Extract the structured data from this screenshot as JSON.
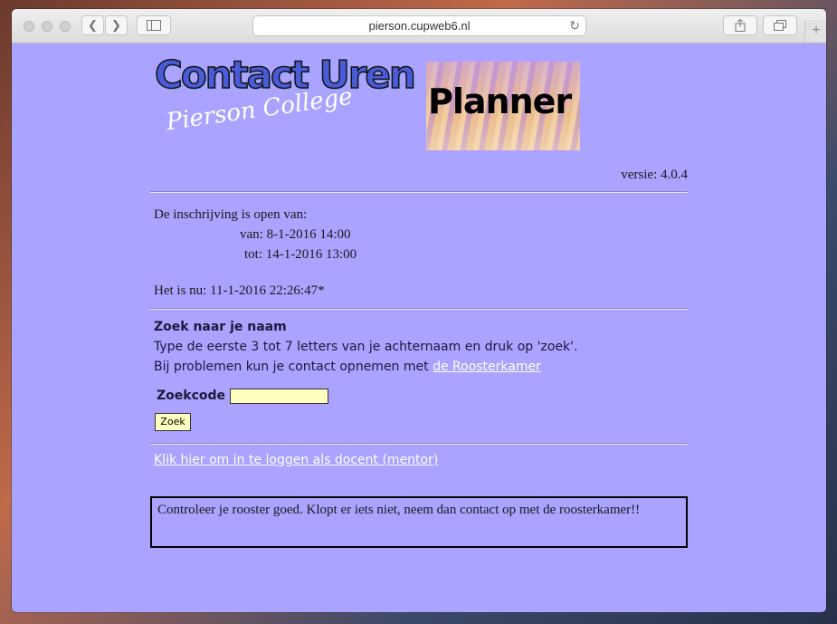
{
  "browser": {
    "url": "pierson.cupweb6.nl"
  },
  "logo": {
    "title": "Contact Uren",
    "subtitle": "Pierson College",
    "planner": "Planner"
  },
  "version": "versie: 4.0.4",
  "registration": {
    "intro": "De inschrijving is open van:",
    "from": "van: 8-1-2016 14:00",
    "to": "tot: 14-1-2016 13:00",
    "now": "Het is nu: 11-1-2016 22:26:47*"
  },
  "search": {
    "heading": "Zoek naar je naam",
    "instructions": "Type de eerste 3 tot 7 letters van je achternaam en druk op 'zoek'.",
    "problems_prefix": "Bij problemen kun je contact opnemen met",
    "problems_link": "de Roosterkamer",
    "field_label": "Zoekcode",
    "field_value": "",
    "button_label": "Zoek"
  },
  "teacher_login_link": "Klik hier om in te loggen als docent (mentor)",
  "notice": "Controleer je rooster goed. Klopt er iets niet, neem dan contact op met de roosterkamer!!"
}
